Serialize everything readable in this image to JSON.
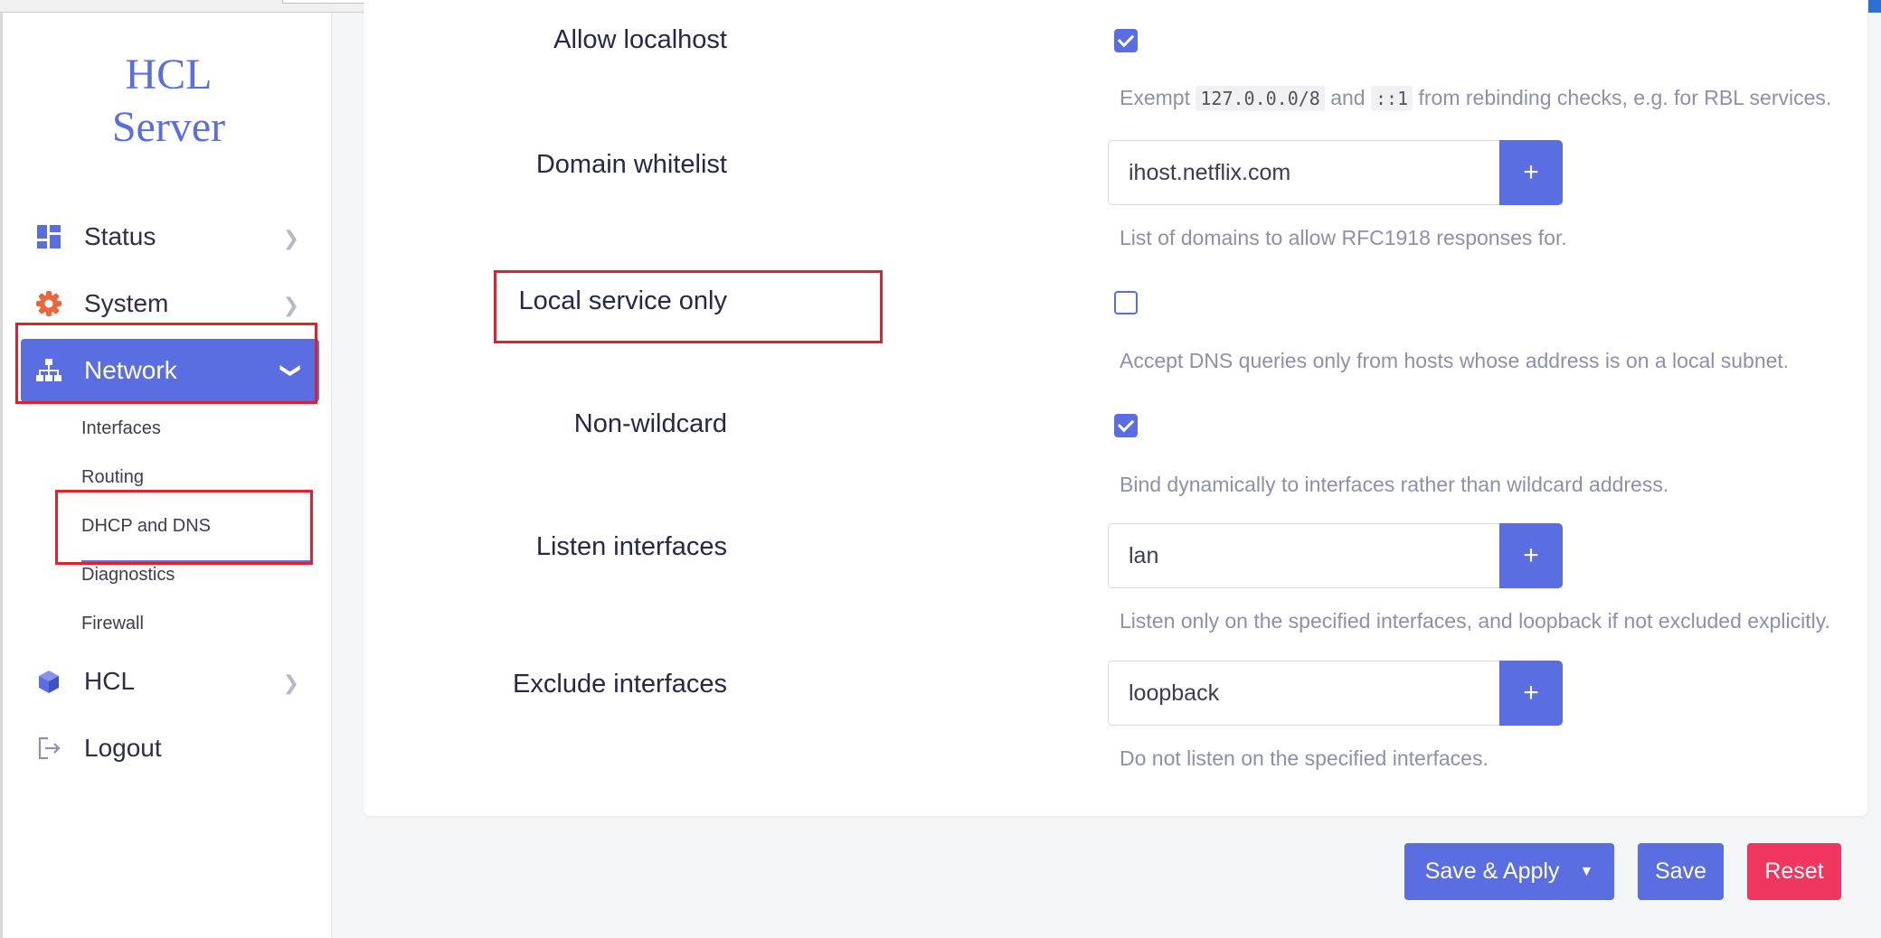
{
  "brand": {
    "line1": "HCL",
    "line2": "Server"
  },
  "nav": {
    "status": "Status",
    "system": "System",
    "network": "Network",
    "network_children": [
      "Interfaces",
      "Routing",
      "DHCP and DNS",
      "Diagnostics",
      "Firewall"
    ],
    "hcl": "HCL",
    "logout": "Logout"
  },
  "form": {
    "allow_localhost": {
      "label": "Allow localhost",
      "checked": true,
      "desc_pre": "Exempt",
      "code1": "127.0.0.0/8",
      "desc_mid": "and",
      "code2": "::1",
      "desc_post": "from rebinding checks, e.g. for RBL services."
    },
    "domain_whitelist": {
      "label": "Domain whitelist",
      "value": "ihost.netflix.com",
      "desc": "List of domains to allow RFC1918 responses for."
    },
    "local_service_only": {
      "label": "Local service only",
      "checked": false,
      "desc": "Accept DNS queries only from hosts whose address is on a local subnet."
    },
    "non_wildcard": {
      "label": "Non-wildcard",
      "checked": true,
      "desc": "Bind dynamically to interfaces rather than wildcard address."
    },
    "listen_interfaces": {
      "label": "Listen interfaces",
      "value": "lan",
      "desc": "Listen only on the specified interfaces, and loopback if not excluded explicitly."
    },
    "exclude_interfaces": {
      "label": "Exclude interfaces",
      "value": "loopback",
      "desc": "Do not listen on the specified interfaces."
    },
    "add_symbol": "+"
  },
  "actions": {
    "save_apply": "Save & Apply",
    "save_apply_caret": "▼",
    "save": "Save",
    "reset": "Reset"
  },
  "colors": {
    "accent": "#5b6ee1",
    "danger": "#f0355f",
    "highlight": "#e0202a",
    "system_icon": "#f0643a"
  }
}
